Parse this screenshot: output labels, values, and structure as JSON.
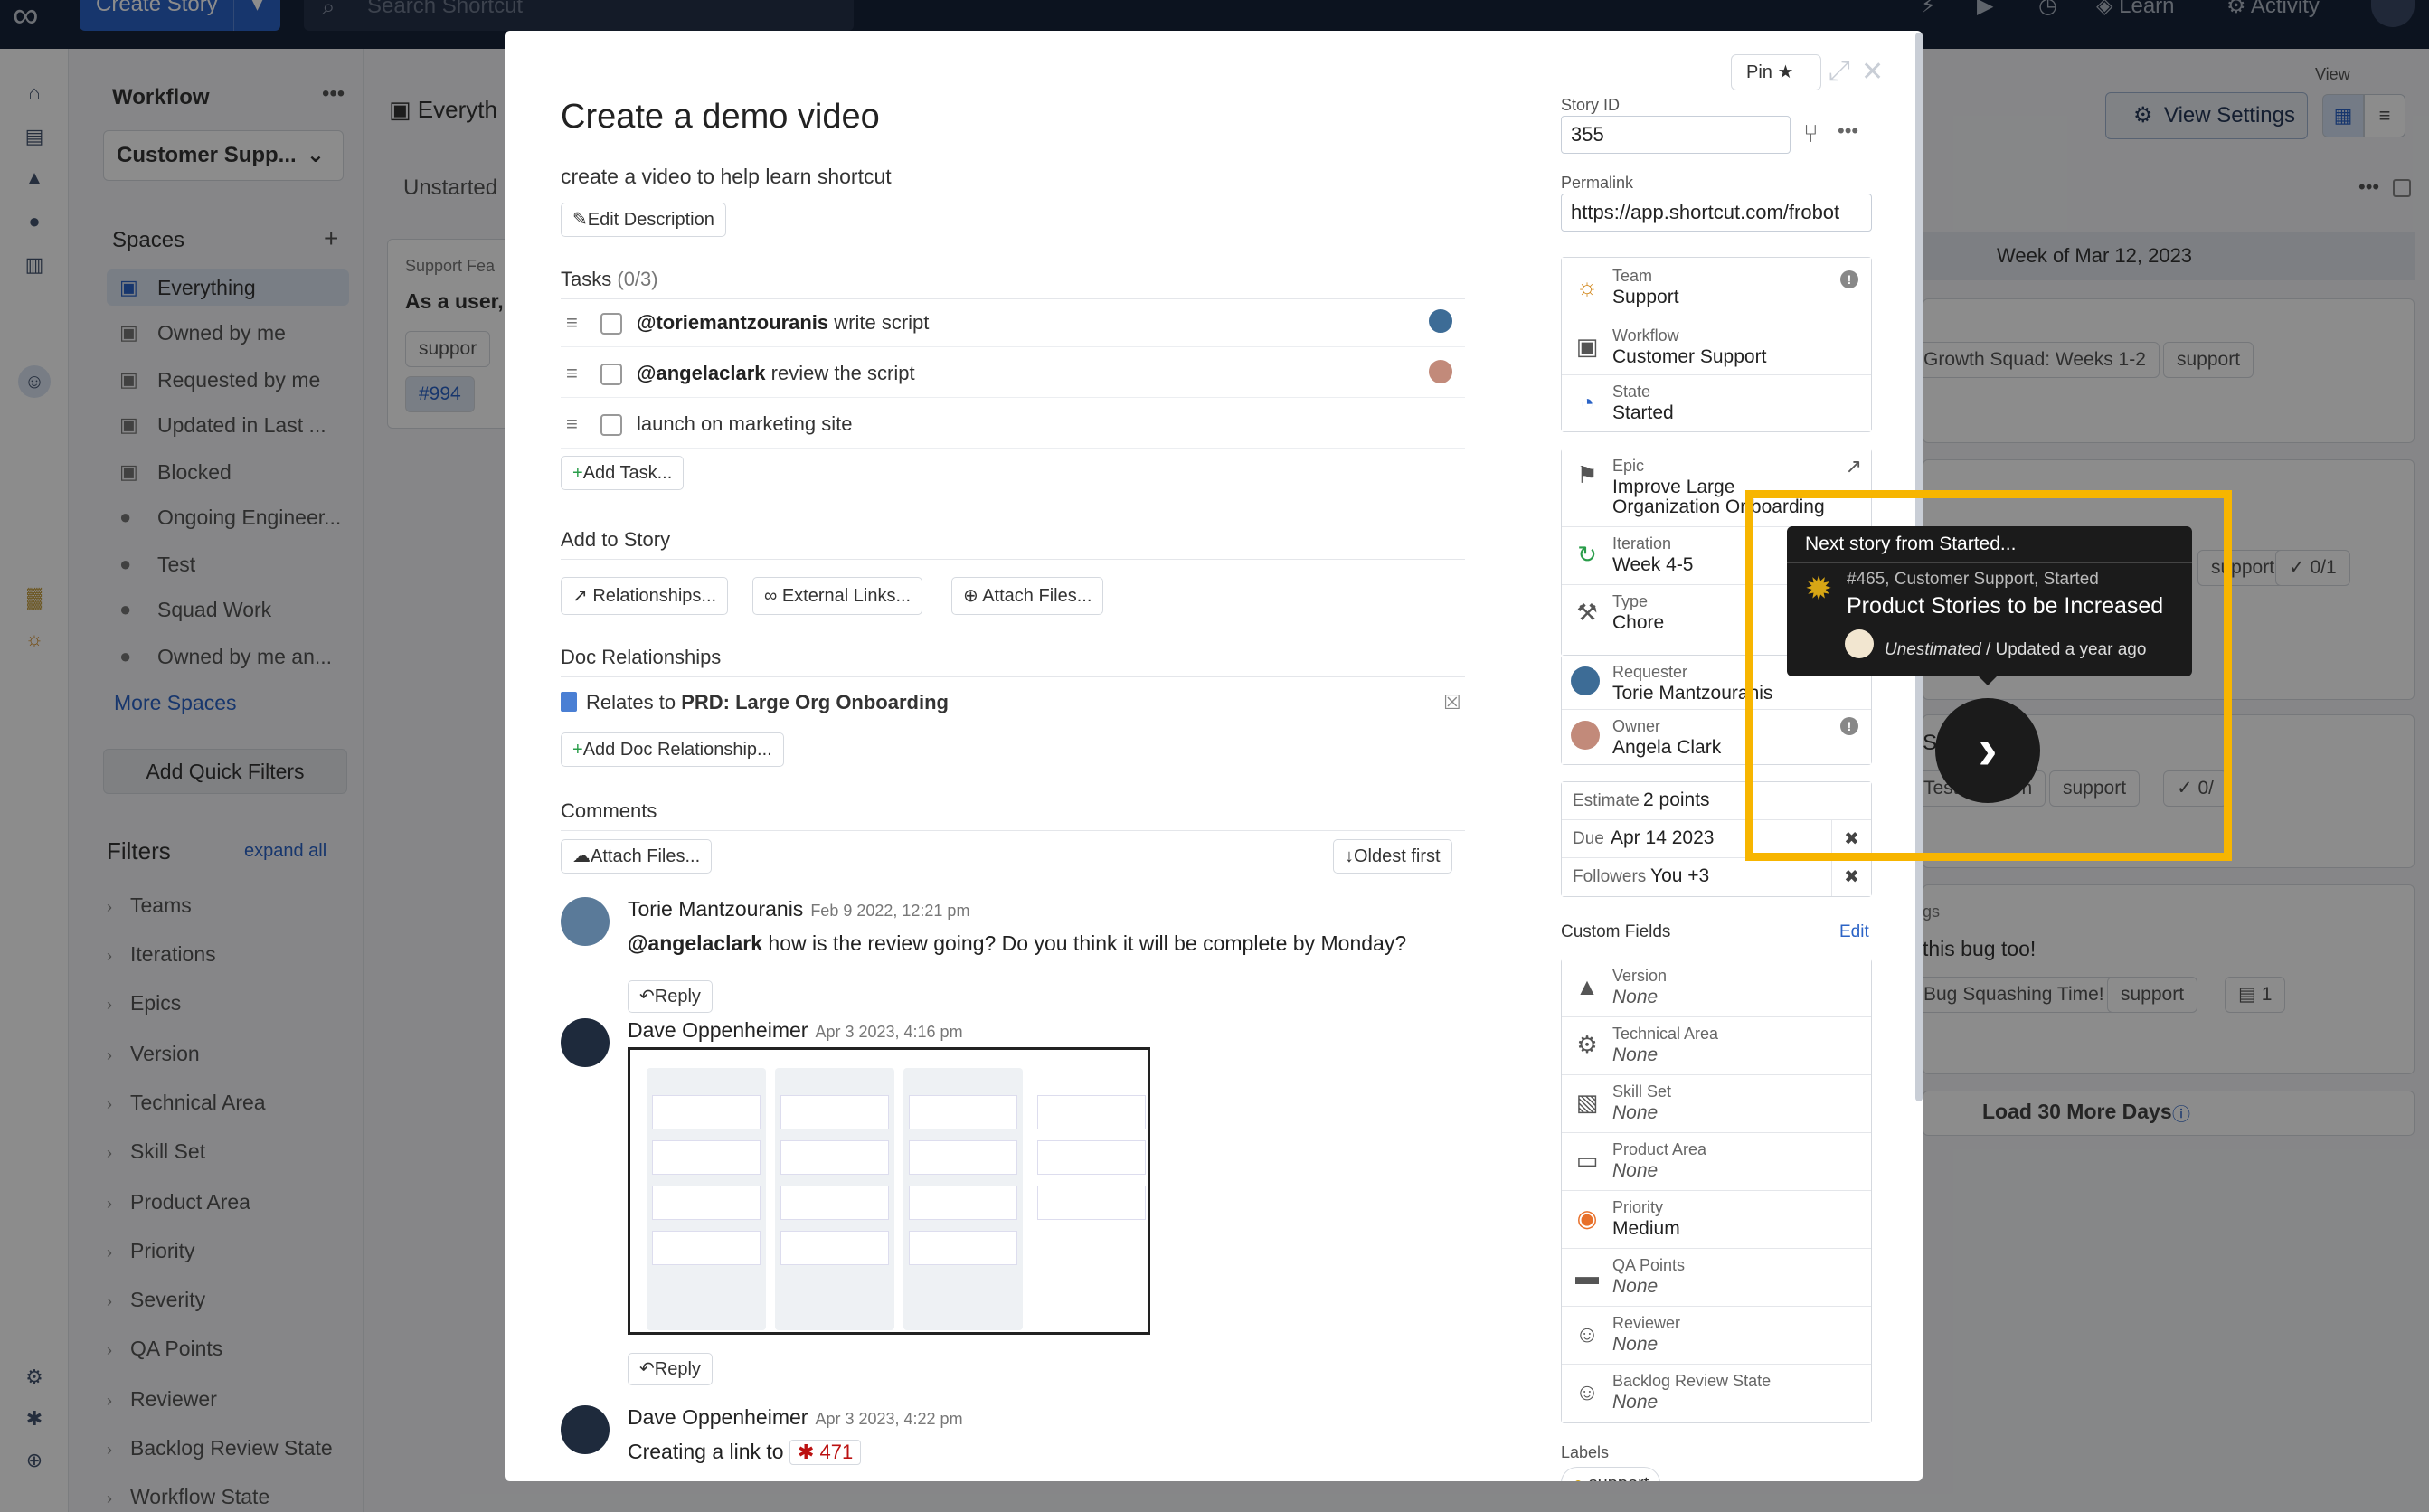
{
  "topbar": {
    "create_story": "Create Story",
    "search_placeholder": "Search Shortcut",
    "learn": "Learn",
    "activity": "Activity"
  },
  "sidebar": {
    "workflow_title": "Workflow",
    "workflow_value": "Customer Supp...",
    "spaces_title": "Spaces",
    "spaces": [
      {
        "label": "Everything",
        "active": true
      },
      {
        "label": "Owned by me"
      },
      {
        "label": "Requested by me"
      },
      {
        "label": "Updated in Last ..."
      },
      {
        "label": "Blocked"
      },
      {
        "label": "Ongoing Engineer..."
      },
      {
        "label": "Test"
      },
      {
        "label": "Squad Work"
      },
      {
        "label": "Owned by me an..."
      }
    ],
    "more_spaces": "More Spaces",
    "add_quick_filters": "Add Quick Filters",
    "filters_title": "Filters",
    "expand_all": "expand all",
    "filters": [
      "Teams",
      "Iterations",
      "Epics",
      "Version",
      "Technical Area",
      "Skill Set",
      "Product Area",
      "Priority",
      "Severity",
      "QA Points",
      "Reviewer",
      "Backlog Review State",
      "Workflow State"
    ]
  },
  "background": {
    "view_label": "View",
    "view_settings": "View Settings",
    "page_title": "Everyth",
    "unstarted": "Unstarted",
    "card_label": "Support Fea",
    "card_text": "As a user, I",
    "card_chip": "suppor",
    "card_id": "#994",
    "week": "Week of Mar 12, 2023",
    "r1_chip1": "Growth Squad: Weeks 1-2",
    "r1_chip2": "support",
    "r2_chip2": "support",
    "r2_chip3": "0/1",
    "r3_text": "Story",
    "r3_chip1": "Test Iteration",
    "r3_chip2": "support",
    "r3_chip3": "0/",
    "r4_label": "gs",
    "r4_text": "this bug too!",
    "r4_chip1": "Bug Squashing Time!",
    "r4_chip2": "support",
    "r4_chip3": "1",
    "load_more": "Load 30 More Days"
  },
  "modal": {
    "title": "Create a demo video",
    "description": "create a video to help learn shortcut",
    "edit_description": "Edit Description",
    "pin": "Pin",
    "tasks_label": "Tasks",
    "tasks_count": "(0/3)",
    "tasks": [
      {
        "mention": "@toriemantzouranis",
        "text": " write script"
      },
      {
        "mention": "@angelaclark",
        "text": " review the script"
      },
      {
        "mention": "",
        "text": "launch on marketing site"
      }
    ],
    "add_task": "Add Task...",
    "add_to_story": "Add to Story",
    "relationships": "Relationships...",
    "external_links": "External Links...",
    "attach_files": "Attach Files...",
    "doc_relationships": "Doc Relationships",
    "relates_to": "Relates to",
    "doc_name": "PRD: Large Org Onboarding",
    "add_doc_relationship": "Add Doc Relationship...",
    "comments_label": "Comments",
    "comments_attach": "Attach Files...",
    "oldest_first": "Oldest first",
    "comments": [
      {
        "name": "Torie Mantzouranis",
        "date": "Feb 9 2022, 12:21 pm",
        "mention": "@angelaclark",
        "body": " how is the review going? Do you think it will be complete by Monday?",
        "reply": "Reply"
      },
      {
        "name": "Dave Oppenheimer",
        "date": "Apr 3 2023, 4:16 pm",
        "reply": "Reply"
      },
      {
        "name": "Dave Oppenheimer",
        "date": "Apr 3 2023, 4:22 pm",
        "body": "Creating a link to",
        "link": "471"
      }
    ],
    "story_id_label": "Story ID",
    "story_id": "355",
    "permalink_label": "Permalink",
    "permalink": "https://app.shortcut.com/frobot",
    "fields": {
      "team_label": "Team",
      "team": "Support",
      "workflow_label": "Workflow",
      "workflow": "Customer Support",
      "state_label": "State",
      "state": "Started",
      "epic_label": "Epic",
      "epic_line1": "Improve Large",
      "epic_line2": "Organization Onboarding",
      "iteration_label": "Iteration",
      "iteration": "Week 4-5",
      "type_label": "Type",
      "type": "Chore",
      "requester_label": "Requester",
      "requester": "Torie Mantzouranis",
      "owner_label": "Owner",
      "owner": "Angela Clark",
      "estimate_label": "Estimate",
      "estimate": "2 points",
      "due_label": "Due",
      "due": "Apr 14 2023",
      "followers_label": "Followers",
      "followers": "You +3"
    },
    "custom_fields_label": "Custom Fields",
    "custom_fields_edit": "Edit",
    "custom_fields": [
      {
        "label": "Version",
        "value": "None",
        "icon": "mountain-icon"
      },
      {
        "label": "Technical Area",
        "value": "None",
        "icon": "gear-icon"
      },
      {
        "label": "Skill Set",
        "value": "None",
        "icon": "briefcase-icon"
      },
      {
        "label": "Product Area",
        "value": "None",
        "icon": "monitor-icon"
      },
      {
        "label": "Priority",
        "value": "Medium",
        "icon": "priority-icon"
      },
      {
        "label": "QA Points",
        "value": "None",
        "icon": "folder-icon"
      },
      {
        "label": "Reviewer",
        "value": "None",
        "icon": "face-icon"
      },
      {
        "label": "Backlog Review State",
        "value": "None",
        "icon": "face-icon"
      }
    ],
    "labels_label": "Labels",
    "label_chip": "support"
  },
  "tooltip": {
    "header": "Next story from Started...",
    "meta": "#465, Customer Support, Started",
    "title": "Product Stories to be Increased",
    "estimate": "Unestimated",
    "updated": " / Updated a year ago"
  },
  "colors": {
    "highlight": "#f7b500",
    "accent": "#2b63c6",
    "topbar": "#17233a"
  }
}
